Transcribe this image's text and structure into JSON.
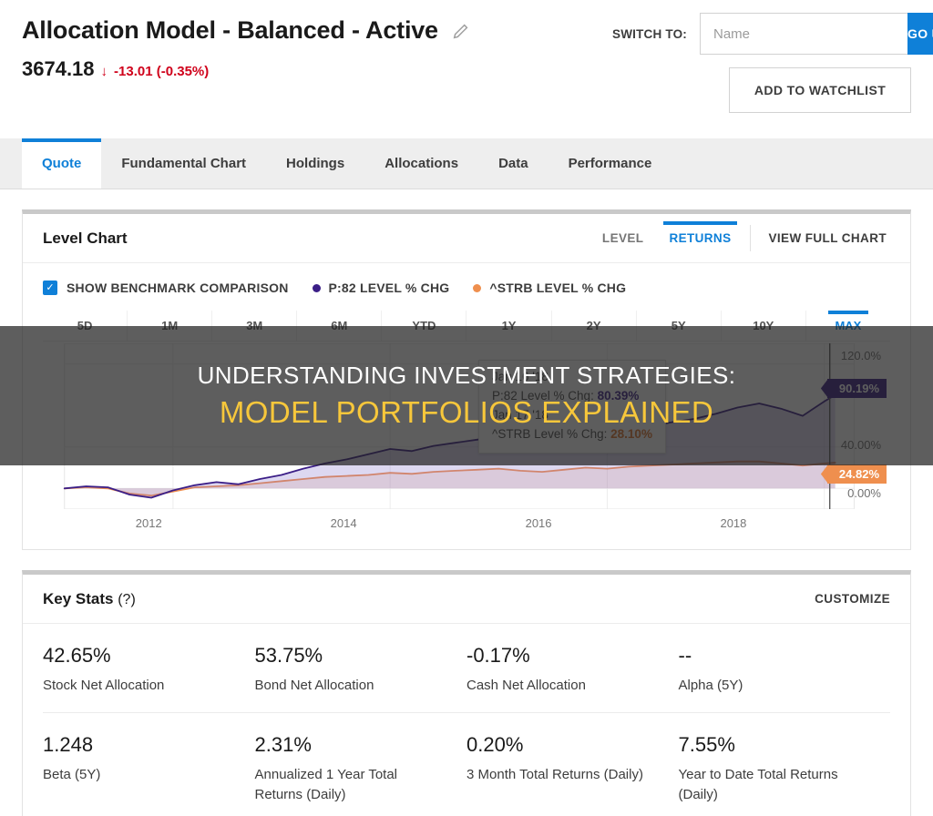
{
  "header": {
    "title": "Allocation Model - Balanced - Active",
    "edit_icon": "pencil-icon",
    "price": "3674.18",
    "change_arrow": "↓",
    "change": "-13.01 (-0.35%)",
    "switch_label": "SWITCH TO:",
    "switch_placeholder": "Name",
    "switch_value": "",
    "go_label": "GO",
    "watchlist_label": "ADD TO WATCHLIST"
  },
  "tabs": [
    {
      "label": "Quote",
      "active": true
    },
    {
      "label": "Fundamental Chart",
      "active": false
    },
    {
      "label": "Holdings",
      "active": false
    },
    {
      "label": "Allocations",
      "active": false
    },
    {
      "label": "Data",
      "active": false
    },
    {
      "label": "Performance",
      "active": false
    }
  ],
  "level_chart": {
    "title": "Level Chart",
    "mode_level": "LEVEL",
    "mode_returns": "RETURNS",
    "view_full": "VIEW FULL CHART",
    "benchmark_label": "SHOW BENCHMARK COMPARISON",
    "benchmark_checked": true,
    "series_1_label": "P:82 LEVEL % CHG",
    "series_1_color": "#3b1e87",
    "series_2_label": "^STRB LEVEL % CHG",
    "series_2_color": "#ef8f4e",
    "ranges": [
      "5D",
      "1M",
      "3M",
      "6M",
      "YTD",
      "1Y",
      "2Y",
      "5Y",
      "10Y",
      "MAX"
    ],
    "active_range": "MAX",
    "tooltip": {
      "date_1": "Jan 16 '18",
      "row_1_label": "P:82 Level % Chg:",
      "row_1_value": "80.39%",
      "date_2": "Jan 17 '18",
      "row_2_label": "^STRB Level % Chg:",
      "row_2_value": "28.10%"
    },
    "badge_purple": "90.19%",
    "badge_orange": "24.82%"
  },
  "chart_data": {
    "type": "line",
    "title": "Level Chart",
    "xlabel": "",
    "ylabel": "",
    "ylim": [
      -20,
      140
    ],
    "yticks": [
      "0.00%",
      "40.00%",
      "120.0%"
    ],
    "ytick_values": [
      0,
      40,
      120
    ],
    "xticks": [
      "2012",
      "2014",
      "2016",
      "2018"
    ],
    "xtick_values": [
      2012,
      2014,
      2016,
      2018
    ],
    "grid": true,
    "legend_position": "top",
    "series": [
      {
        "name": "P:82 LEVEL % CHG",
        "color": "#3b1e87",
        "last_value": 90.19,
        "x": [
          2011.0,
          2011.2,
          2011.4,
          2011.6,
          2011.8,
          2012.0,
          2012.2,
          2012.4,
          2012.6,
          2012.8,
          2013.0,
          2013.2,
          2013.4,
          2013.6,
          2013.8,
          2014.0,
          2014.2,
          2014.4,
          2014.6,
          2014.8,
          2015.0,
          2015.2,
          2015.4,
          2015.6,
          2015.8,
          2016.0,
          2016.2,
          2016.4,
          2016.6,
          2016.8,
          2017.0,
          2017.2,
          2017.4,
          2017.6,
          2017.8,
          2018.0,
          2018.1
        ],
        "values": [
          0,
          2,
          1,
          -6,
          -9,
          -2,
          3,
          6,
          4,
          9,
          13,
          19,
          24,
          28,
          33,
          38,
          36,
          41,
          44,
          47,
          50,
          46,
          43,
          48,
          52,
          50,
          55,
          60,
          64,
          67,
          72,
          78,
          82,
          77,
          70,
          84,
          90.19
        ]
      },
      {
        "name": "^STRB LEVEL % CHG",
        "color": "#ef8f4e",
        "last_value": 24.82,
        "x": [
          2011.0,
          2011.2,
          2011.4,
          2011.6,
          2011.8,
          2012.0,
          2012.2,
          2012.4,
          2012.6,
          2012.8,
          2013.0,
          2013.2,
          2013.4,
          2013.6,
          2013.8,
          2014.0,
          2014.2,
          2014.4,
          2014.6,
          2014.8,
          2015.0,
          2015.2,
          2015.4,
          2015.6,
          2015.8,
          2016.0,
          2016.2,
          2016.4,
          2016.6,
          2016.8,
          2017.0,
          2017.2,
          2017.4,
          2017.6,
          2017.8,
          2018.0,
          2018.1
        ],
        "values": [
          0,
          1,
          0,
          -5,
          -7,
          -3,
          1,
          2,
          3,
          5,
          7,
          9,
          11,
          12,
          13,
          15,
          14,
          16,
          17,
          18,
          19,
          17,
          16,
          18,
          20,
          19,
          21,
          22,
          23,
          24,
          25,
          26,
          26,
          24,
          22,
          24,
          24.82
        ]
      }
    ]
  },
  "key_stats": {
    "title": "Key Stats",
    "help_icon": "(?)",
    "customize_label": "CUSTOMIZE",
    "items": [
      {
        "value": "42.65%",
        "label": "Stock Net Allocation"
      },
      {
        "value": "53.75%",
        "label": "Bond Net Allocation"
      },
      {
        "value": "-0.17%",
        "label": "Cash Net Allocation"
      },
      {
        "value": "--",
        "label": "Alpha (5Y)"
      },
      {
        "value": "1.248",
        "label": "Beta (5Y)"
      },
      {
        "value": "2.31%",
        "label": "Annualized 1 Year Total Returns (Daily)"
      },
      {
        "value": "0.20%",
        "label": "3 Month Total Returns (Daily)"
      },
      {
        "value": "7.55%",
        "label": "Year to Date Total Returns (Daily)"
      }
    ]
  },
  "overlay": {
    "line1": "UNDERSTANDING INVESTMENT STRATEGIES:",
    "line2": "MODEL PORTFOLIOS EXPLAINED"
  }
}
